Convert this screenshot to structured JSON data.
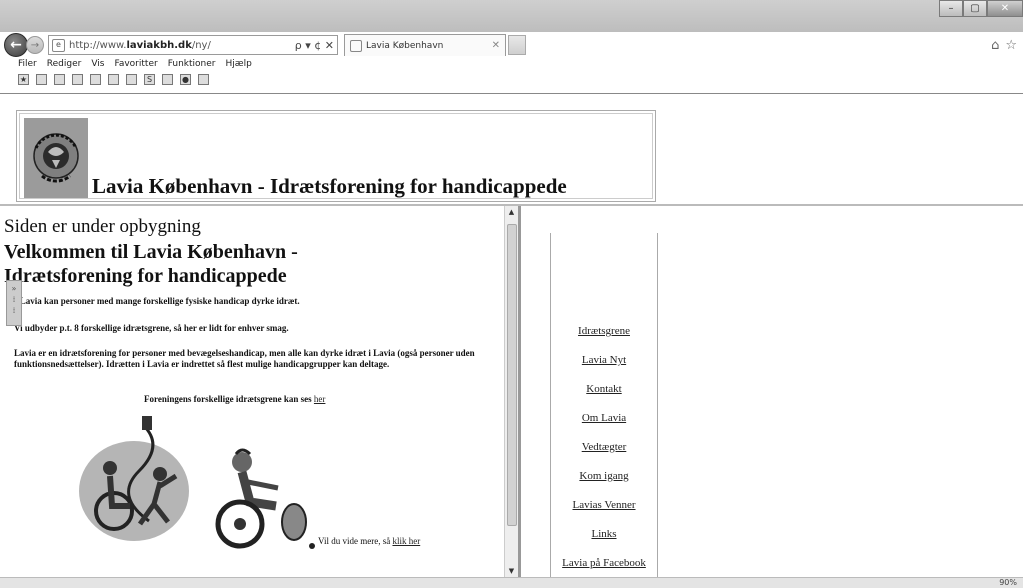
{
  "browser": {
    "url_prefix": "http://www.",
    "url_domain": "laviakbh.dk",
    "url_path": "/ny/",
    "tab_title": "Lavia København",
    "address_controls": "ρ ▾ ¢ ✕",
    "window_controls": {
      "minimize": "–",
      "maximize": "▢",
      "close": "✕"
    },
    "menu": [
      "Filer",
      "Rediger",
      "Vis",
      "Favoritter",
      "Funktioner",
      "Hjælp"
    ],
    "right_icons": [
      "home-icon",
      "star-icon"
    ],
    "zoom": "90%"
  },
  "header": {
    "site_title": "Lavia København - Idrætsforening for handicappede",
    "logo_text": "IDRÆTSFORENINGEN LAVIA"
  },
  "main": {
    "under_construction": "Siden er under opbygning",
    "welcome_heading": "Velkommen til Lavia København - Idrætsforening for handicappede",
    "para1": "I Lavia kan personer med mange forskellige fysiske handicap dyrke idræt.",
    "para2": "Vi udbyder p.t. 8 forskellige idrætsgrene, så her er lidt for enhver smag.",
    "para3": "Lavia er en idrætsforening for personer med bevægelseshandicap, men alle kan dyrke idræt i Lavia (også personer uden funktionsnedsættelser). Idrætten i Lavia er indrettet så flest mulige handicapgrupper kan deltage.",
    "para4_text": "Foreningens forskellige idrætsgrene kan ses ",
    "para4_link": "her",
    "para5_text": "Vil du vide mere, så ",
    "para5_link": "klik her"
  },
  "nav": {
    "items": [
      "Idrætsgrene",
      "Lavia Nyt",
      "Kontakt",
      "Om Lavia",
      "Vedtægter",
      "Kom igang",
      "Lavias Venner",
      "Links",
      "Lavia på Facebook"
    ]
  }
}
